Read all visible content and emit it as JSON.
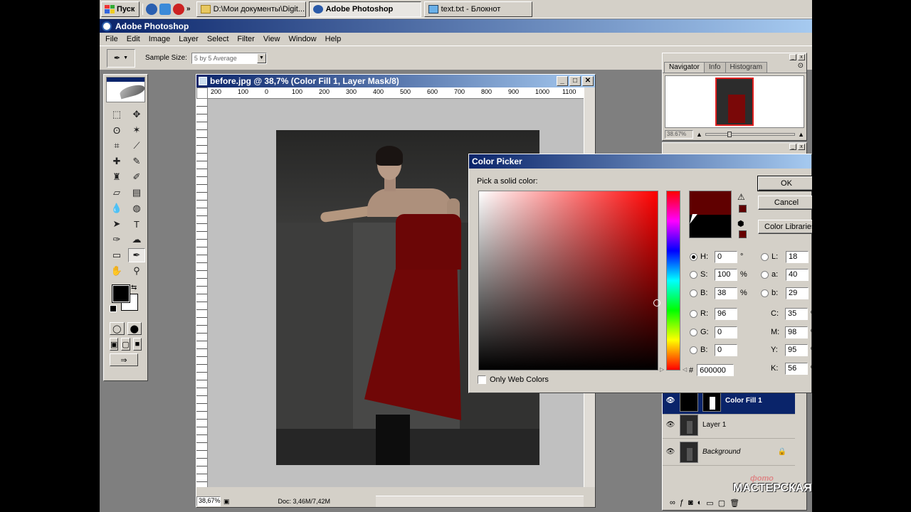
{
  "taskbar": {
    "start_label": "Пуск",
    "tasks": [
      {
        "label": "D:\\Мои документы\\Digit..."
      },
      {
        "label": "Adobe Photoshop"
      },
      {
        "label": "text.txt - Блокнот"
      }
    ],
    "quick_more": "»"
  },
  "app": {
    "title": "Adobe Photoshop",
    "menu": [
      "File",
      "Edit",
      "Image",
      "Layer",
      "Select",
      "Filter",
      "View",
      "Window",
      "Help"
    ]
  },
  "options": {
    "sample_size_label": "Sample Size:",
    "sample_size_value": "5 by 5 Average"
  },
  "document": {
    "title": "before.jpg @ 38,7% (Color Fill 1, Layer Mask/8)",
    "ruler_h": [
      "200",
      "100",
      "0",
      "100",
      "200",
      "300",
      "400",
      "500",
      "600",
      "700",
      "800",
      "900",
      "1000",
      "1100"
    ],
    "zoom": "38,67%",
    "doc_size": "Doc: 3,46M/7,42M"
  },
  "navigator": {
    "tabs": [
      "Navigator",
      "Info",
      "Histogram"
    ],
    "zoom": "38.67%"
  },
  "layers": [
    {
      "name": "Color Fill 1",
      "selected": true
    },
    {
      "name": "Layer 1",
      "selected": false
    },
    {
      "name": "Background",
      "selected": false
    }
  ],
  "color_picker": {
    "title": "Color Picker",
    "prompt": "Pick a solid color:",
    "buttons": {
      "ok": "OK",
      "cancel": "Cancel",
      "libraries": "Color Libraries"
    },
    "hsb": [
      {
        "label": "H:",
        "value": "0",
        "unit": "°",
        "checked": true
      },
      {
        "label": "S:",
        "value": "100",
        "unit": "%",
        "checked": false
      },
      {
        "label": "B:",
        "value": "38",
        "unit": "%",
        "checked": false
      }
    ],
    "rgb": [
      {
        "label": "R:",
        "value": "96"
      },
      {
        "label": "G:",
        "value": "0"
      },
      {
        "label": "B:",
        "value": "0"
      }
    ],
    "lab": [
      {
        "label": "L:",
        "value": "18"
      },
      {
        "label": "a:",
        "value": "40"
      },
      {
        "label": "b:",
        "value": "29"
      }
    ],
    "cmyk": [
      {
        "label": "C:",
        "value": "35",
        "unit": "%"
      },
      {
        "label": "M:",
        "value": "98",
        "unit": "%"
      },
      {
        "label": "Y:",
        "value": "95",
        "unit": "%"
      },
      {
        "label": "K:",
        "value": "56",
        "unit": "%"
      }
    ],
    "hex_label": "#",
    "hex": "600000",
    "web_only_label": "Only Web Colors",
    "new_color": "#600000",
    "old_color": "#000000",
    "gamut_swatch": "#600000",
    "web_swatch": "#660000"
  },
  "watermark": {
    "line1": "фото",
    "line2": "МАСТЕРСКАЯ"
  }
}
